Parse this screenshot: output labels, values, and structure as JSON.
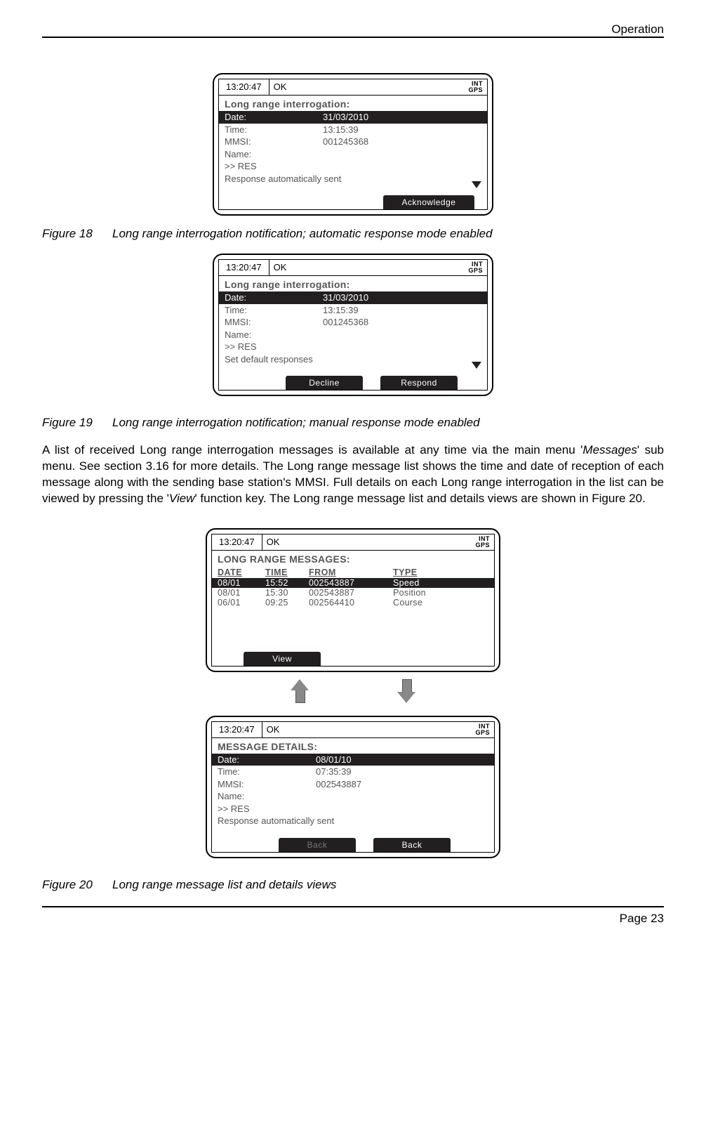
{
  "doc": {
    "section": "Operation",
    "page_label": "Page 23"
  },
  "captions": {
    "fig18_num": "Figure 18",
    "fig18_txt": "Long range interrogation notification; automatic response mode enabled",
    "fig19_num": "Figure 19",
    "fig19_txt": "Long range interrogation notification; manual response mode enabled",
    "fig20_num": "Figure 20",
    "fig20_txt": "Long range message list and details views"
  },
  "paragraph": {
    "p1a": "A list of received Long range interrogation messages is available at any time via the main menu '",
    "p1b": "Messages",
    "p1c": "' sub menu. See section 3.16 for more details. The Long range message list shows the time and date of reception of each message along with the sending base station's MMSI. Full details on each Long range interrogation in the list can be viewed by pressing the '",
    "p1d": "View",
    "p1e": "' function key. The Long range message list and details views are shown in Figure 20."
  },
  "common": {
    "time": "13:20:47",
    "status": "OK",
    "gps1": "INT",
    "gps2": "GPS"
  },
  "panel18": {
    "title": "Long range interrogation:",
    "rows": {
      "date_k": "Date:",
      "date_v": "31/03/2010",
      "time_k": "Time:",
      "time_v": "13:15:39",
      "mmsi_k": "MMSI:",
      "mmsi_v": "001245368",
      "name_k": "Name:",
      "name_v": "",
      "res": ">> RES",
      "footer": "Response automatically sent"
    },
    "btn": "Acknowledge"
  },
  "panel19": {
    "title": "Long range interrogation:",
    "rows": {
      "date_k": "Date:",
      "date_v": "31/03/2010",
      "time_k": "Time:",
      "time_v": "13:15:39",
      "mmsi_k": "MMSI:",
      "mmsi_v": "001245368",
      "name_k": "Name:",
      "name_v": "",
      "res": ">> RES",
      "footer": "Set default responses"
    },
    "btn1": "Decline",
    "btn2": "Respond"
  },
  "panel_list": {
    "title": "LONG RANGE MESSAGES:",
    "head": {
      "date": "DATE",
      "time": "TIME",
      "from": "FROM",
      "type": "TYPE"
    },
    "rows": [
      {
        "date": "08/01",
        "time": "15:52",
        "from": "002543887",
        "type": "Speed",
        "sel": true
      },
      {
        "date": "08/01",
        "time": "15:30",
        "from": "002543887",
        "type": "Position",
        "sel": false
      },
      {
        "date": "06/01",
        "time": "09:25",
        "from": "002564410",
        "type": "Course",
        "sel": false
      }
    ],
    "btn": "View"
  },
  "panel_detail": {
    "title": "MESSAGE DETAILS:",
    "rows": {
      "date_k": "Date:",
      "date_v": "08/01/10",
      "time_k": "Time:",
      "time_v": "07:35:39",
      "mmsi_k": "MMSI:",
      "mmsi_v": "002543887",
      "name_k": "Name:",
      "name_v": "",
      "res": ">> RES",
      "footer": "Response automatically sent"
    },
    "btn_ghost": "Back",
    "btn": "Back"
  }
}
